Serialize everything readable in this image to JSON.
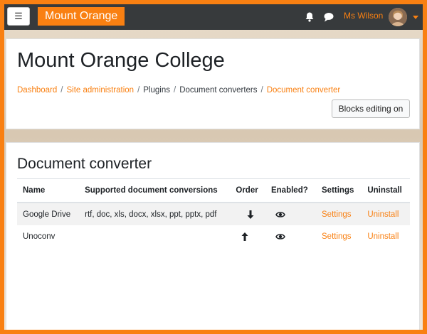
{
  "navbar": {
    "menu_glyph": "☰",
    "brand": "Mount Orange",
    "user_name": "Ms Wilson",
    "icons": [
      "bell-icon",
      "chat-icon",
      "caret-down-icon"
    ]
  },
  "header": {
    "site_title": "Mount Orange College",
    "breadcrumb": [
      {
        "label": "Dashboard",
        "link": true
      },
      {
        "label": "Site administration",
        "link": true
      },
      {
        "label": "Plugins",
        "link": false
      },
      {
        "label": "Document converters",
        "link": false
      },
      {
        "label": "Document converter",
        "link": true
      }
    ],
    "blocks_editing_label": "Blocks editing on"
  },
  "main": {
    "heading": "Document converter",
    "table": {
      "columns": [
        "Name",
        "Supported document conversions",
        "Order",
        "Enabled?",
        "Settings",
        "Uninstall"
      ],
      "rows": [
        {
          "name": "Google Drive",
          "conversions": "rtf, doc, xls, docx, xlsx, ppt, pptx, pdf",
          "order_icon": "arrow-down-icon",
          "enabled_icon": "eye-icon",
          "settings": "Settings",
          "uninstall": "Uninstall"
        },
        {
          "name": "Unoconv",
          "conversions": "",
          "order_icon": "arrow-up-icon",
          "enabled_icon": "eye-icon",
          "settings": "Settings",
          "uninstall": "Uninstall"
        }
      ]
    }
  },
  "colors": {
    "accent": "#f98012",
    "navbar": "#373a3c"
  }
}
